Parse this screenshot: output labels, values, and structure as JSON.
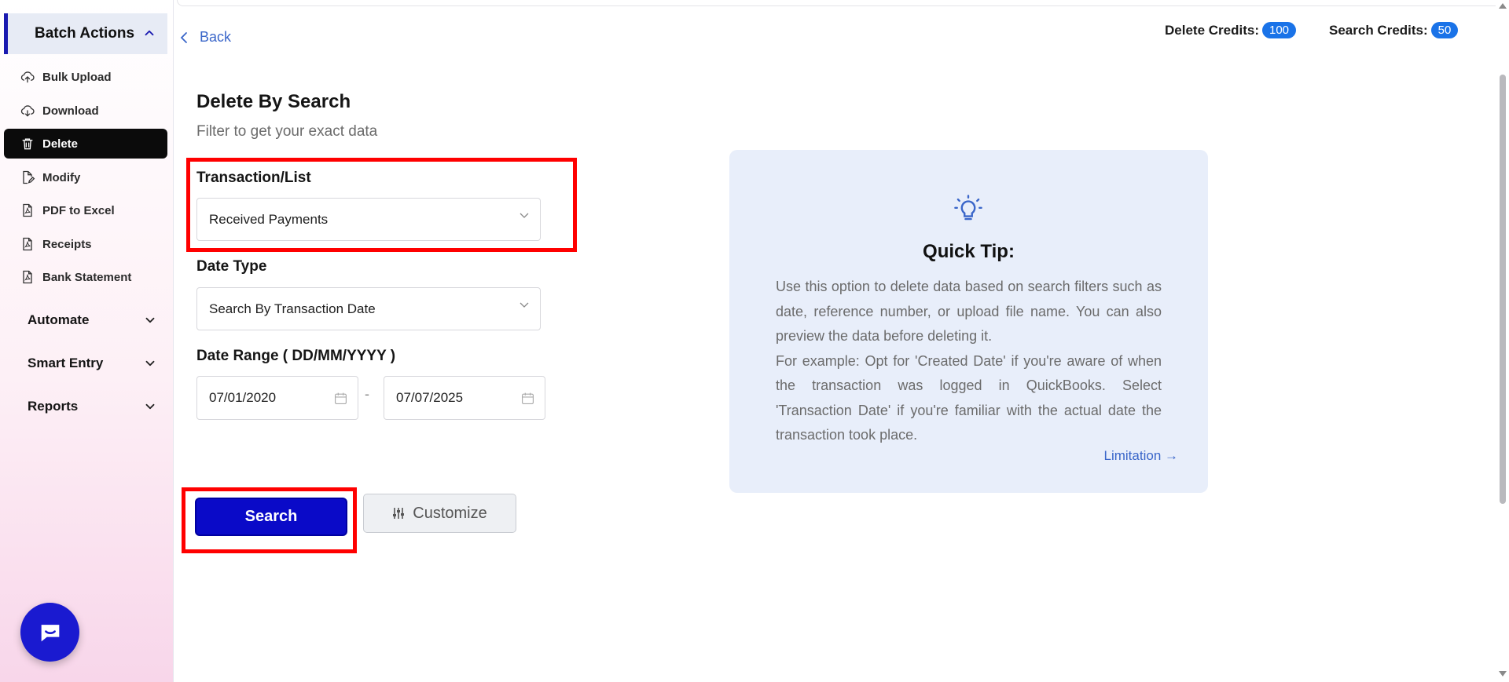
{
  "sidebar": {
    "section_title": "Batch Actions",
    "items": [
      {
        "label": "Bulk Upload",
        "icon": "cloud-upload-icon"
      },
      {
        "label": "Download",
        "icon": "cloud-download-icon"
      },
      {
        "label": "Delete",
        "icon": "trash-icon",
        "active": true
      },
      {
        "label": "Modify",
        "icon": "file-edit-icon"
      },
      {
        "label": "PDF to Excel",
        "icon": "pdf-file-icon"
      },
      {
        "label": "Receipts",
        "icon": "pdf-file-icon"
      },
      {
        "label": "Bank Statement",
        "icon": "pdf-file-icon"
      }
    ],
    "groups": [
      {
        "label": "Automate"
      },
      {
        "label": "Smart Entry"
      },
      {
        "label": "Reports"
      }
    ]
  },
  "header": {
    "back_label": "Back",
    "delete_credits_label": "Delete Credits:",
    "delete_credits_value": "100",
    "search_credits_label": "Search Credits:",
    "search_credits_value": "50"
  },
  "form": {
    "title": "Delete By Search",
    "subtitle": "Filter to get your exact data",
    "transaction_label": "Transaction/List",
    "transaction_value": "Received Payments",
    "date_type_label": "Date Type",
    "date_type_value": "Search By Transaction Date",
    "date_range_label": "Date Range ( DD/MM/YYYY )",
    "date_from": "07/01/2020",
    "date_separator": "-",
    "date_to": "07/07/2025",
    "search_button": "Search",
    "customize_button": "Customize"
  },
  "tip": {
    "title": "Quick Tip:",
    "paragraph1": "Use this option to delete data based on search filters such as date, reference number, or upload file name. You can also preview the data before deleting it.",
    "paragraph2": "For example: Opt for 'Created Date' if you're aware of when the transaction was logged in QuickBooks. Select 'Transaction Date' if you're familiar with the actual date the transaction took place.",
    "link": "Limitation →"
  },
  "colors": {
    "accent": "#0a0ac8",
    "link": "#3a66c9",
    "badge": "#1a73e8",
    "highlight": "#ff0000",
    "tip_bg": "#e8eefa"
  }
}
